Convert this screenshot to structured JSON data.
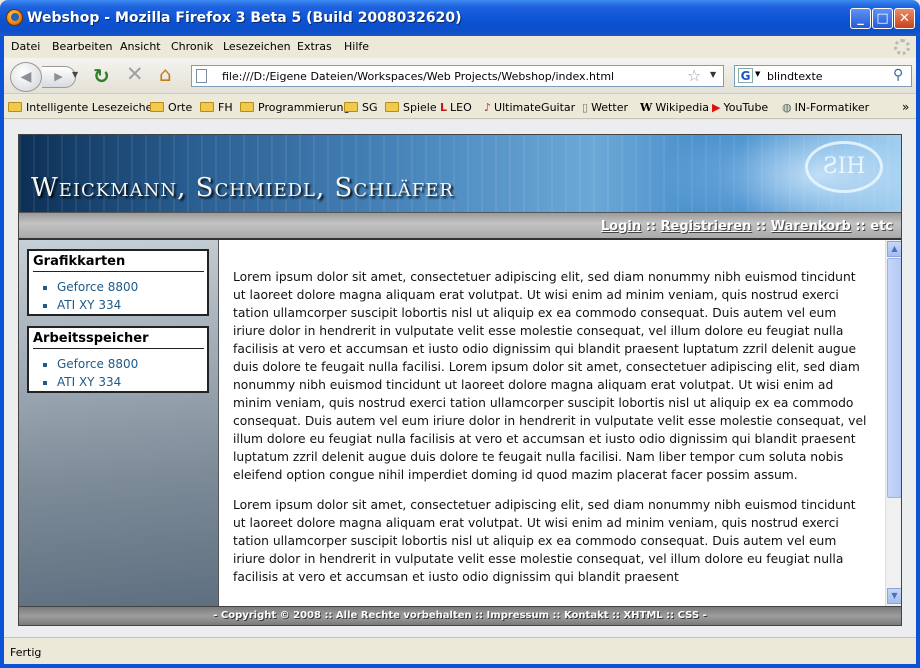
{
  "window": {
    "title": "Webshop - Mozilla Firefox 3 Beta 5 (Build 2008032620)",
    "min_label": "_",
    "max_label": "□",
    "close_label": "✕"
  },
  "menubar": {
    "items": [
      "Datei",
      "Bearbeiten",
      "Ansicht",
      "Chronik",
      "Lesezeichen",
      "Extras",
      "Hilfe"
    ]
  },
  "navbar": {
    "back_label": "◀",
    "forward_label": "▶",
    "url": "file:///D:/Eigene Dateien/Workspaces/Web Projects/Webshop/index.html",
    "search_value": "blindtexte",
    "search_engine": "G"
  },
  "bookmarks": {
    "items": [
      {
        "label": "Intelligente Lesezeichen",
        "icon": "folder-icon"
      },
      {
        "label": "Orte",
        "icon": "folder-icon"
      },
      {
        "label": "FH",
        "icon": "folder-icon"
      },
      {
        "label": "Programmierung",
        "icon": "folder-icon"
      },
      {
        "label": "SG",
        "icon": "folder-icon"
      },
      {
        "label": "Spiele",
        "icon": "folder-icon"
      },
      {
        "label": "LEO",
        "icon": "leo-icon"
      },
      {
        "label": "UltimateGuitar",
        "icon": "guitar-icon"
      },
      {
        "label": "Wetter",
        "icon": "page-icon"
      },
      {
        "label": "Wikipedia",
        "icon": "wikipedia-icon"
      },
      {
        "label": "YouTube",
        "icon": "youtube-icon"
      },
      {
        "label": "IN-Formatiker",
        "icon": "globe-icon"
      }
    ],
    "more": "»"
  },
  "site": {
    "title": "Weickmann, Schmiedl, Schläfer",
    "logo_text": "ƧIH",
    "topnav": {
      "login": "Login",
      "register": "Registrieren",
      "cart": "Warenkorb",
      "etc": "etc",
      "sep": " :: "
    },
    "sidebar": [
      {
        "title": "Grafikkarten",
        "items": [
          "Geforce 8800",
          "ATI XY 334"
        ]
      },
      {
        "title": "Arbeitsspeicher",
        "items": [
          "Geforce 8800",
          "ATI XY 334"
        ]
      }
    ],
    "paragraphs": [
      "Lorem ipsum dolor sit amet, consectetuer adipiscing elit, sed diam nonummy nibh euismod tincidunt ut laoreet dolore magna aliquam erat volutpat. Ut wisi enim ad minim veniam, quis nostrud exerci tation ullamcorper suscipit lobortis nisl ut aliquip ex ea commodo consequat. Duis autem vel eum iriure dolor in hendrerit in vulputate velit esse molestie consequat, vel illum dolore eu feugiat nulla facilisis at vero et accumsan et iusto odio dignissim qui blandit praesent luptatum zzril delenit augue duis dolore te feugait nulla facilisi. Lorem ipsum dolor sit amet, consectetuer adipiscing elit, sed diam nonummy nibh euismod tincidunt ut laoreet dolore magna aliquam erat volutpat. Ut wisi enim ad minim veniam, quis nostrud exerci tation ullamcorper suscipit lobortis nisl ut aliquip ex ea commodo consequat. Duis autem vel eum iriure dolor in hendrerit in vulputate velit esse molestie consequat, vel illum dolore eu feugiat nulla facilisis at vero et accumsan et iusto odio dignissim qui blandit praesent luptatum zzril delenit augue duis dolore te feugait nulla facilisi. Nam liber tempor cum soluta nobis eleifend option congue nihil imperdiet doming id quod mazim placerat facer possim assum.",
      "Lorem ipsum dolor sit amet, consectetuer adipiscing elit, sed diam nonummy nibh euismod tincidunt ut laoreet dolore magna aliquam erat volutpat. Ut wisi enim ad minim veniam, quis nostrud exerci tation ullamcorper suscipit lobortis nisl ut aliquip ex ea commodo consequat. Duis autem vel eum iriure dolor in hendrerit in vulputate velit esse molestie consequat, vel illum dolore eu feugiat nulla facilisis at vero et accumsan et iusto odio dignissim qui blandit praesent"
    ],
    "footer": "- Copyright © 2008 :: Alle Rechte vorbehalten :: Impressum :: Kontakt :: XHTML :: CSS -"
  },
  "statusbar": {
    "text": "Fertig"
  },
  "colors": {
    "titlebar": "#0b52d6",
    "link": "#1e5a8a"
  }
}
